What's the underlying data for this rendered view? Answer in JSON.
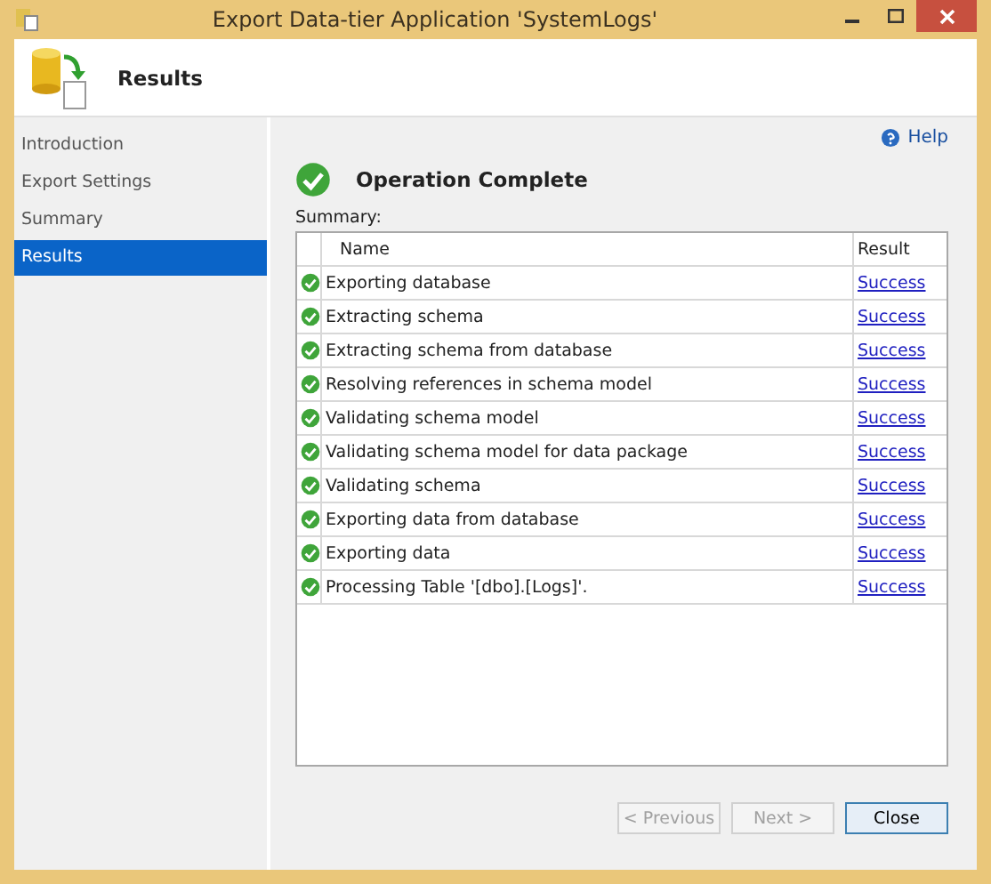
{
  "window": {
    "title": "Export Data-tier Application 'SystemLogs'"
  },
  "header": {
    "title": "Results"
  },
  "sidebar": {
    "items": [
      {
        "label": "Introduction",
        "selected": false
      },
      {
        "label": "Export Settings",
        "selected": false
      },
      {
        "label": "Summary",
        "selected": false
      },
      {
        "label": "Results",
        "selected": true
      }
    ]
  },
  "help_link": "Help",
  "status": "Operation Complete",
  "summary_label": "Summary:",
  "table": {
    "columns": [
      "Name",
      "Result"
    ],
    "rows": [
      {
        "name": "Exporting database",
        "result": "Success"
      },
      {
        "name": "Extracting schema",
        "result": "Success"
      },
      {
        "name": "Extracting schema from database",
        "result": "Success"
      },
      {
        "name": "Resolving references in schema model",
        "result": "Success"
      },
      {
        "name": "Validating schema model",
        "result": "Success"
      },
      {
        "name": "Validating schema model for data package",
        "result": "Success"
      },
      {
        "name": "Validating schema",
        "result": "Success"
      },
      {
        "name": "Exporting data from database",
        "result": "Success"
      },
      {
        "name": "Exporting data",
        "result": "Success"
      },
      {
        "name": "Processing Table '[dbo].[Logs]'.",
        "result": "Success"
      }
    ]
  },
  "buttons": [
    {
      "label": "< Previous",
      "disabled": true
    },
    {
      "label": "Next >",
      "disabled": true
    },
    {
      "label": "Close",
      "disabled": false
    }
  ]
}
